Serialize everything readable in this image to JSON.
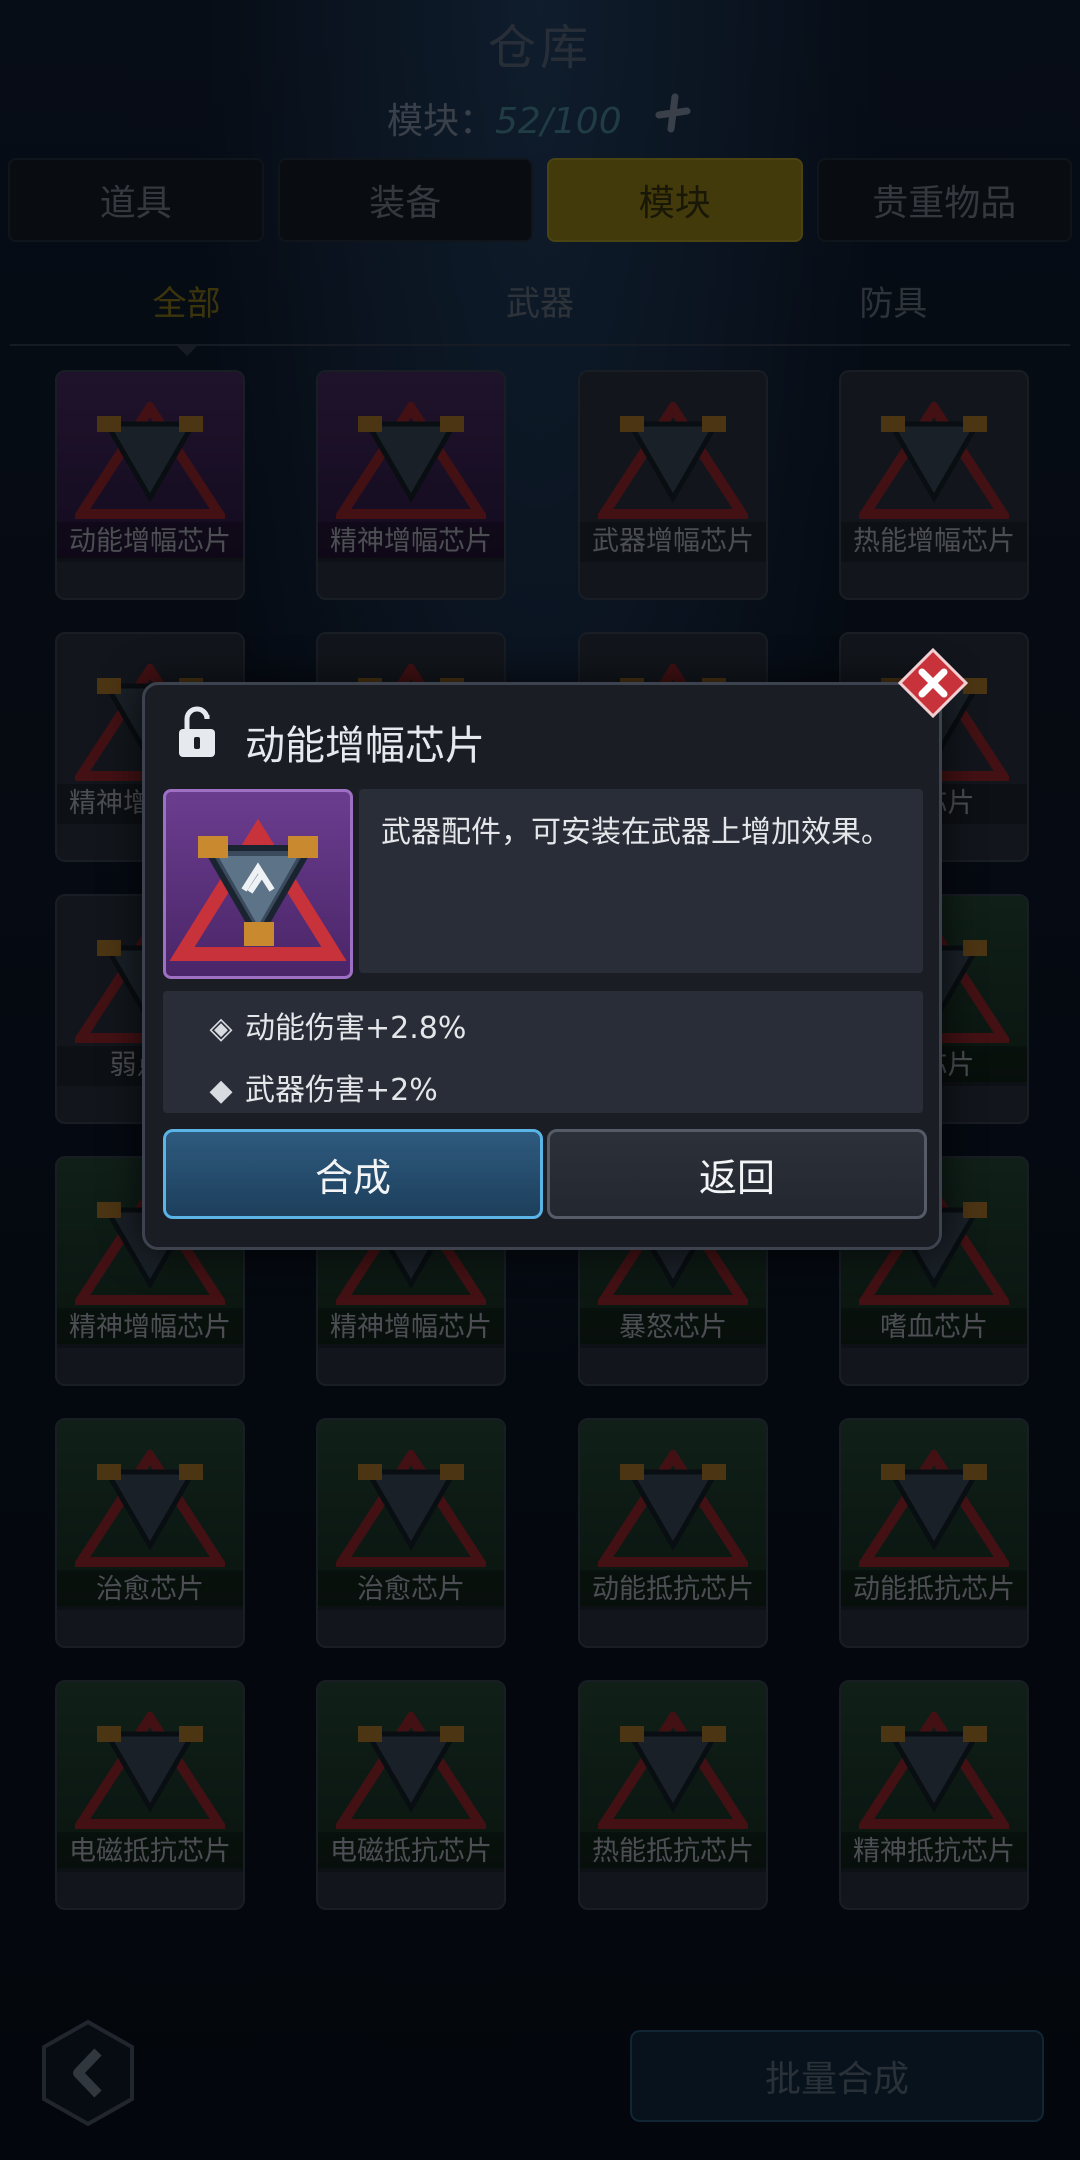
{
  "header": {
    "title": "仓库",
    "capacity_label": "模块：",
    "capacity_value": "52/100"
  },
  "tabs": [
    "道具",
    "装备",
    "模块",
    "贵重物品"
  ],
  "active_tab": "模块",
  "subtabs": [
    "全部",
    "武器",
    "防具"
  ],
  "active_subtab": "全部",
  "items": [
    {
      "label": "动能增幅芯片",
      "rarity": "purple"
    },
    {
      "label": "精神增幅芯片",
      "rarity": "purple"
    },
    {
      "label": "武器增幅芯片",
      "rarity": "gray"
    },
    {
      "label": "热能增幅芯片",
      "rarity": "gray"
    },
    {
      "label": "精神增幅芯片",
      "rarity": "gray"
    },
    {
      "label": "",
      "rarity": "gray"
    },
    {
      "label": "",
      "rarity": "gray"
    },
    {
      "label": "兵芯片",
      "rarity": "gray"
    },
    {
      "label": "弱点加",
      "rarity": "gray"
    },
    {
      "label": "",
      "rarity": "gray"
    },
    {
      "label": "",
      "rarity": "gray"
    },
    {
      "label": "幅芯片",
      "rarity": "green"
    },
    {
      "label": "精神增幅芯片",
      "rarity": "green"
    },
    {
      "label": "精神增幅芯片",
      "rarity": "green"
    },
    {
      "label": "暴怒芯片",
      "rarity": "green"
    },
    {
      "label": "嗜血芯片",
      "rarity": "green"
    },
    {
      "label": "治愈芯片",
      "rarity": "green"
    },
    {
      "label": "治愈芯片",
      "rarity": "green"
    },
    {
      "label": "动能抵抗芯片",
      "rarity": "green"
    },
    {
      "label": "动能抵抗芯片",
      "rarity": "green"
    },
    {
      "label": "电磁抵抗芯片",
      "rarity": "green"
    },
    {
      "label": "电磁抵抗芯片",
      "rarity": "green"
    },
    {
      "label": "热能抵抗芯片",
      "rarity": "green"
    },
    {
      "label": "精神抵抗芯片",
      "rarity": "green"
    }
  ],
  "dialog": {
    "title": "动能增幅芯片",
    "description": "武器配件，可安装在武器上增加效果。",
    "stats": [
      "动能伤害+2.8%",
      "武器伤害+2%"
    ],
    "compose_label": "合成",
    "return_label": "返回"
  },
  "footer": {
    "batch_label": "批量合成"
  },
  "colors": {
    "active_tab": "#7a6a17",
    "purple_rarity": "#4a2568",
    "green_rarity": "#1f3a2e",
    "compose_border": "#5ab4e6",
    "close_red": "#c8323a"
  },
  "icons": [
    "plus-icon",
    "lock-icon",
    "close-icon",
    "back-arrow-icon",
    "chip-icon"
  ]
}
